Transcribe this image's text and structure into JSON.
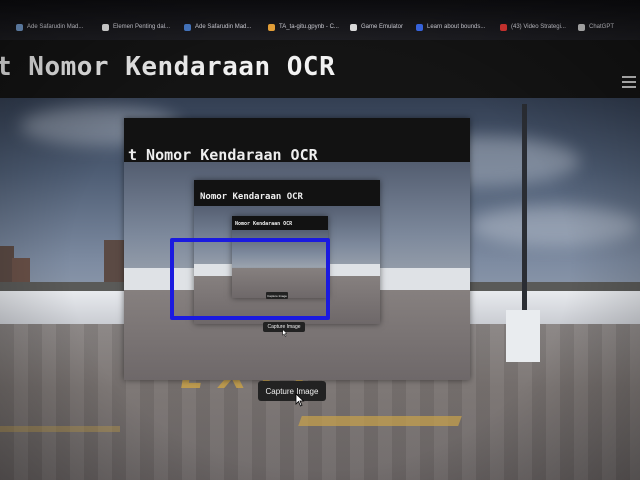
{
  "bookmarks": [
    {
      "label": "Ade Safarudin Mad...",
      "color": "#7aa4d8"
    },
    {
      "label": "Elemen Penting dal...",
      "color": "#f0f0f0"
    },
    {
      "label": "Ade Safarudin Mad...",
      "color": "#4a7fd0"
    },
    {
      "label": "TA_ta-gitu.gpynb - C...",
      "color": "#f2a93b"
    },
    {
      "label": "Game Emulator",
      "color": "#e8e8e8"
    },
    {
      "label": "Learn about bounds...",
      "color": "#3b6cf0"
    },
    {
      "label": "(43) Video Strategi...",
      "color": "#e53935"
    },
    {
      "label": "ChatGPT",
      "color": "#d0d0d0"
    }
  ],
  "header": {
    "title": "t Nomor Kendaraan OCR",
    "menu_icon": "hamburger-icon"
  },
  "nested": {
    "title_1": "t Nomor Kendaraan OCR",
    "title_2": "Nomor Kendaraan OCR",
    "title_3": "Nomor Kendaraan OCR",
    "capture_1": "Capture Image",
    "capture_2": "Capture Image"
  },
  "scene": {
    "floor_paint": "EXIT"
  },
  "capture_button": "Capture Image",
  "colors": {
    "detection_box": "#1a1adf",
    "floor_paint": "#c9a24a",
    "header_bg": "#141414"
  }
}
